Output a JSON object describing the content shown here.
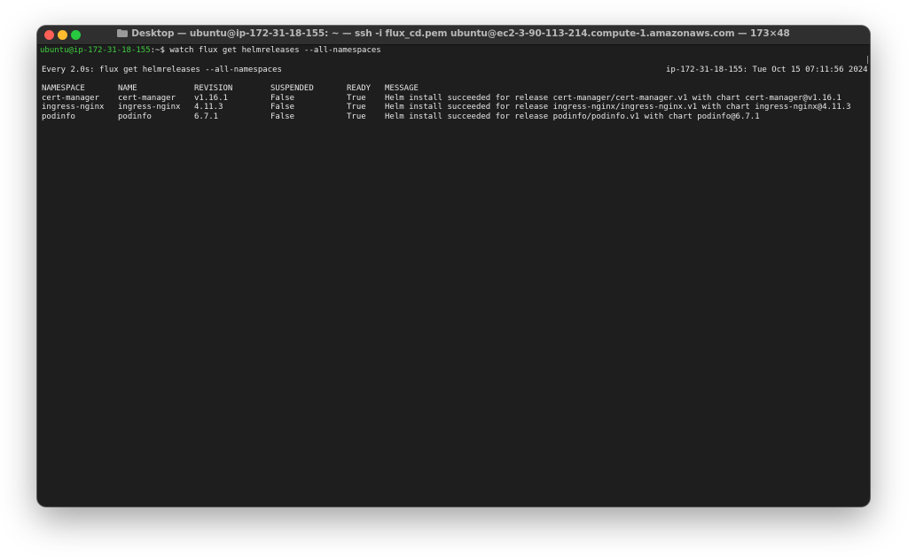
{
  "window": {
    "title": "Desktop — ubuntu@ip-172-31-18-155: ~ — ssh -i flux_cd.pem ubuntu@ec2-3-90-113-214.compute-1.amazonaws.com — 173×48",
    "folder_icon": "folder-icon"
  },
  "terminal": {
    "prompt_user_host": "ubuntu@ip-172-31-18-155",
    "prompt_rest": ":~$ ",
    "command": "watch flux get helmreleases --all-namespaces",
    "watch_header_left": "Every 2.0s: flux get helmreleases --all-namespaces",
    "watch_header_right": "ip-172-31-18-155: Tue Oct 15 07:11:56 2024",
    "columns": [
      "NAMESPACE",
      "NAME",
      "REVISION",
      "SUSPENDED",
      "READY",
      "MESSAGE"
    ],
    "rows": [
      {
        "namespace": "cert-manager",
        "name": "cert-manager",
        "revision": "v1.16.1",
        "suspended": "False",
        "ready": "True",
        "message": "Helm install succeeded for release cert-manager/cert-manager.v1 with chart cert-manager@v1.16.1"
      },
      {
        "namespace": "ingress-nginx",
        "name": "ingress-nginx",
        "revision": "4.11.3",
        "suspended": "False",
        "ready": "True",
        "message": "Helm install succeeded for release ingress-nginx/ingress-nginx.v1 with chart ingress-nginx@4.11.3"
      },
      {
        "namespace": "podinfo",
        "name": "podinfo",
        "revision": "6.7.1",
        "suspended": "False",
        "ready": "True",
        "message": "Helm install succeeded for release podinfo/podinfo.v1 with chart podinfo@6.7.1"
      }
    ]
  },
  "colors": {
    "prompt_green": "#3fce3f",
    "terminal_bg": "#1e1e1e",
    "close": "#fe5f57",
    "minimize": "#febc2e",
    "zoom": "#28c840"
  }
}
